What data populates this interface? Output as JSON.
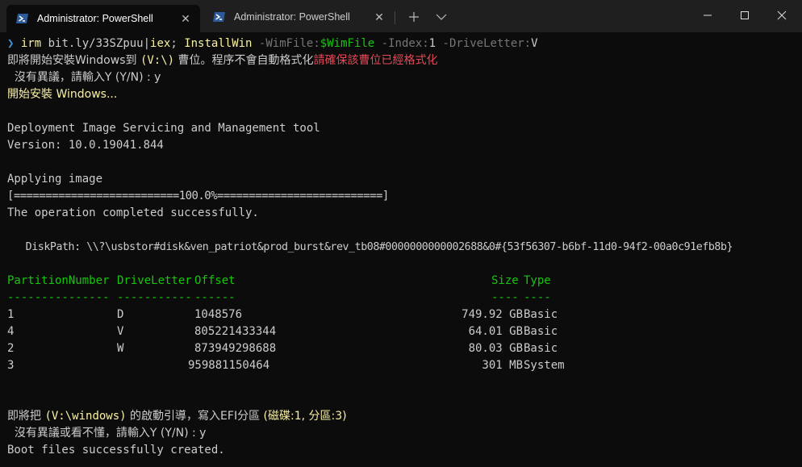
{
  "tabs": [
    {
      "title": "Administrator: PowerShell",
      "active": true
    },
    {
      "title": "Administrator: PowerShell",
      "active": false
    }
  ],
  "colors": {
    "prompt": "#3a96dd",
    "command": "#f9f1a5",
    "parameter": "#767676",
    "variable": "#16c60c",
    "warning": "#e74856",
    "header": "#16c60c"
  },
  "terminal": {
    "prompt_symbol": "❯",
    "cmd_irm": "irm",
    "cmd_url": " bit.ly/33SZpuu",
    "cmd_pipe": "|",
    "cmd_iex": "iex",
    "cmd_semicolon": "; ",
    "cmd_installwin": "InstallWin",
    "param_wimfile": " -WimFile:",
    "var_wimfile": "$WimFile",
    "param_index": " -Index:",
    "val_index": "1",
    "param_driveletter": " -DriveLetter:",
    "val_driveletter": "V",
    "line2_a": "即將開始安裝Windows到 ",
    "line2_b": "(V:\\)",
    "line2_c": " 曹位。程序不會自動格式化",
    "line2_d": "請確保該曹位已經格式化",
    "line3": "  沒有異議，請輸入Y (Y/N) : y",
    "line4": "開始安裝 Windows...",
    "line6": "Deployment Image Servicing and Management tool",
    "line7": "Version: 10.0.19041.844",
    "line9": "Applying image",
    "line10": "[==========================100.0%==========================]",
    "line11": "The operation completed successfully.",
    "line13": "   DiskPath: \\\\?\\usbstor#disk&ven_patriot&prod_burst&rev_tb08#0000000000002688&0#{53f56307-b6bf-11d0-94f2-00a0c91efb8b}",
    "table": {
      "headers": {
        "partition": "PartitionNumber",
        "drive": "DriveLetter",
        "offset": "Offset",
        "size": "Size",
        "type": "Type"
      },
      "underlines": {
        "partition": "---------------",
        "drive": "-----------",
        "offset": "------",
        "size": "----",
        "type": "----"
      },
      "rows": [
        {
          "partition": "1",
          "drive": "D",
          "offset": "1048576",
          "size": "749.92 GB",
          "type": "Basic"
        },
        {
          "partition": "4",
          "drive": "V",
          "offset": "805221433344",
          "size": "64.01 GB",
          "type": "Basic"
        },
        {
          "partition": "2",
          "drive": "W",
          "offset": "873949298688",
          "size": "80.03 GB",
          "type": "Basic"
        },
        {
          "partition": "3",
          "drive": "",
          "offset": "959881150464",
          "size": "301 MB",
          "type": "System"
        }
      ]
    },
    "line_boot_a": "即將把 ",
    "line_boot_b": "(V:\\windows)",
    "line_boot_c": " 的啟動引導，寫入EFI分區 ",
    "line_boot_d": "(磁碟:1, 分區:3)",
    "line_boot2": "  沒有異議或看不懂，請輸入Y (Y/N) : y",
    "line_boot3": "Boot files successfully created."
  }
}
